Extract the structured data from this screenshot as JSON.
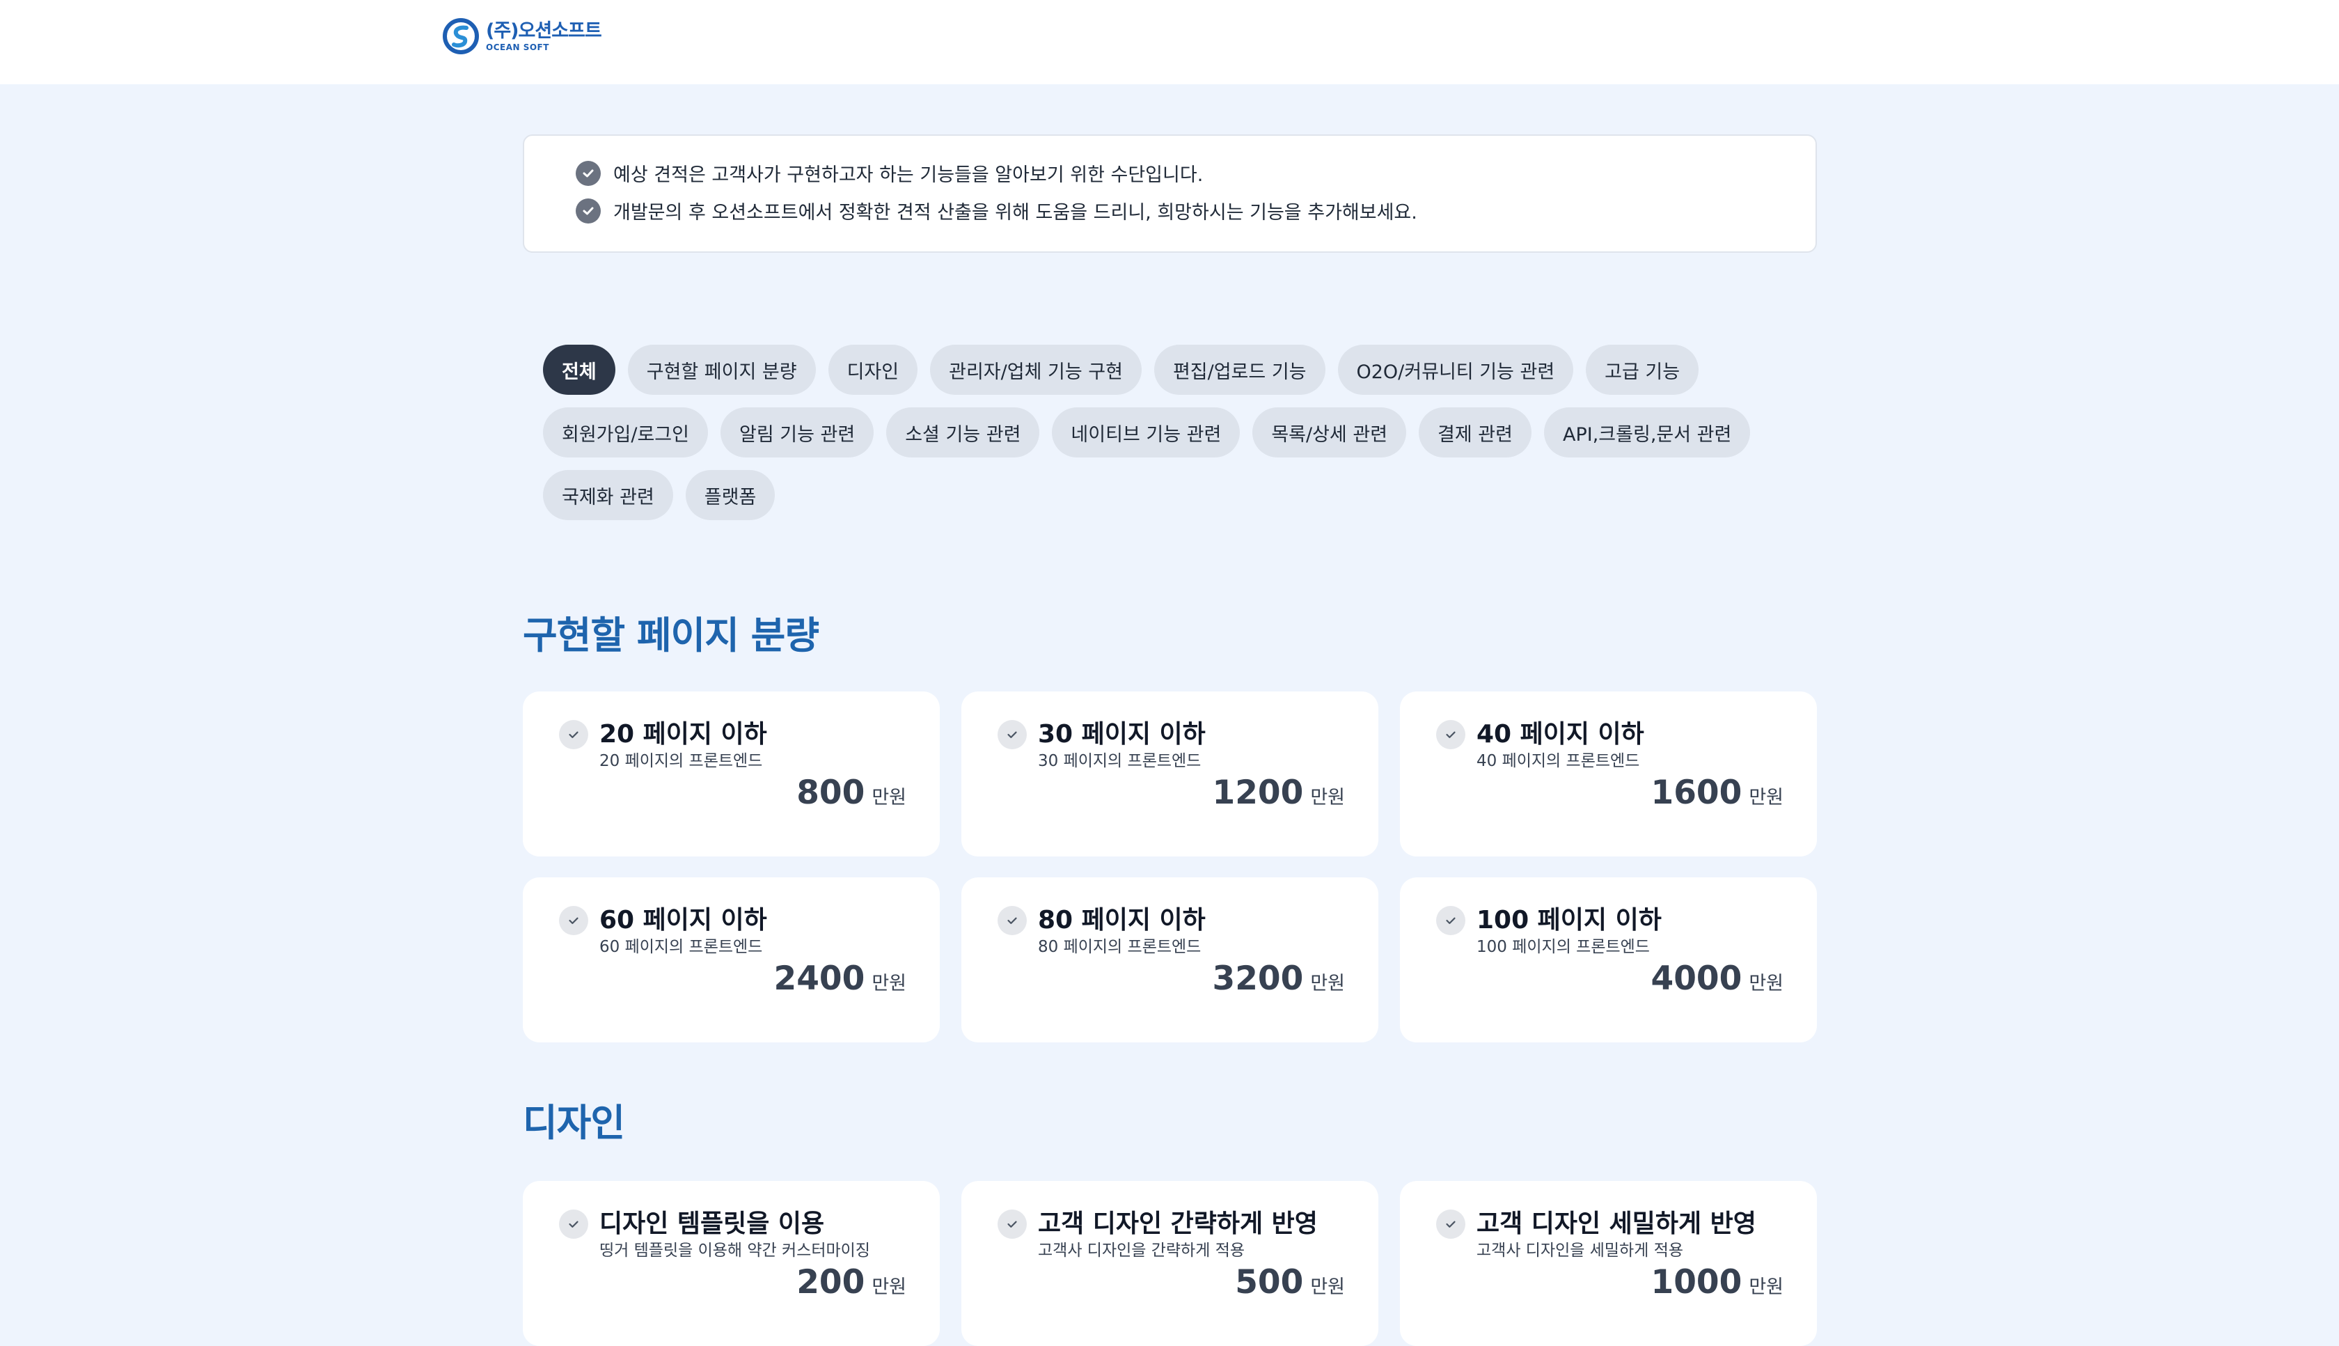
{
  "header": {
    "logo_ko": "(주)오션소프트",
    "logo_en": "OCEAN SOFT"
  },
  "notice": {
    "lines": [
      "예상 견적은 고객사가 구현하고자 하는 기능들을 알아보기 위한 수단입니다.",
      "개발문의 후 오션소프트에서 정확한 견적 산출을 위해 도움을 드리니, 희망하시는 기능을 추가해보세요."
    ]
  },
  "chips": {
    "rows": [
      [
        "전체",
        "구현할 페이지 분량",
        "디자인",
        "관리자/업체 기능 구현",
        "편집/업로드 기능",
        "O2O/커뮤니티 기능 관련",
        "고급 기능"
      ],
      [
        "회원가입/로그인",
        "알림 기능 관련",
        "소셜 기능 관련",
        "네이티브 기능 관련",
        "목록/상세 관련",
        "결제 관련",
        "API,크롤링,문서 관련"
      ],
      [
        "국제화 관련",
        "플랫폼"
      ]
    ],
    "active": "전체"
  },
  "sections": [
    {
      "title": "구현할 페이지 분량",
      "cards": [
        {
          "title": "20 페이지 이하",
          "desc": "20 페이지의 프론트엔드",
          "price": "800",
          "unit": "만원"
        },
        {
          "title": "30 페이지 이하",
          "desc": "30 페이지의 프론트엔드",
          "price": "1200",
          "unit": "만원"
        },
        {
          "title": "40 페이지 이하",
          "desc": "40 페이지의 프론트엔드",
          "price": "1600",
          "unit": "만원"
        },
        {
          "title": "60 페이지 이하",
          "desc": "60 페이지의 프론트엔드",
          "price": "2400",
          "unit": "만원"
        },
        {
          "title": "80 페이지 이하",
          "desc": "80 페이지의 프론트엔드",
          "price": "3200",
          "unit": "만원"
        },
        {
          "title": "100 페이지 이하",
          "desc": "100 페이지의 프론트엔드",
          "price": "4000",
          "unit": "만원"
        }
      ]
    },
    {
      "title": "디자인",
      "cards": [
        {
          "title": "디자인 템플릿을 이용",
          "desc": "띵거 템플릿을 이용해 약간 커스터마이징",
          "price": "200",
          "unit": "만원"
        },
        {
          "title": "고객 디자인 간략하게 반영",
          "desc": "고객사 디자인을 간략하게 적용",
          "price": "500",
          "unit": "만원"
        },
        {
          "title": "고객 디자인 세밀하게 반영",
          "desc": "고객사 디자인을 세밀하게 적용",
          "price": "1000",
          "unit": "만원"
        }
      ]
    }
  ],
  "colors": {
    "page_bg": "#eef4fd",
    "section_title": "#1e64ad",
    "chip_active_bg": "#2d3748",
    "chip_bg": "#dde3ec",
    "logo": "#1e5fb3"
  }
}
